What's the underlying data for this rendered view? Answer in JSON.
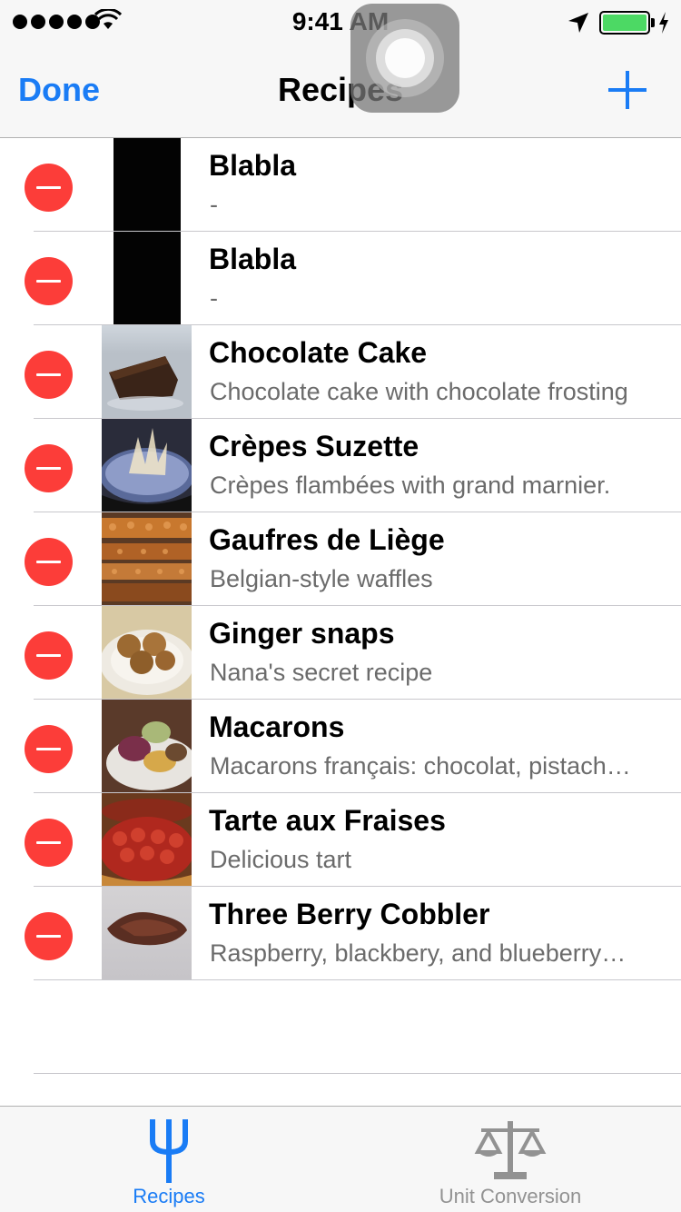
{
  "status_bar": {
    "time": "9:41 AM",
    "signal_bars": 5,
    "battery_level": 1.0,
    "icons": [
      "signal-dots-icon",
      "wifi-icon",
      "location-arrow-icon",
      "battery-icon",
      "charging-bolt-icon"
    ]
  },
  "navbar": {
    "left_button": "Done",
    "title": "Recipes",
    "right_icon": "plus-icon"
  },
  "colors": {
    "tint": "#1a7cf5",
    "delete": "#fc3d39",
    "inactive_tab": "#929292",
    "subtitle": "#6b6b6b"
  },
  "recipes": [
    {
      "title": "Blabla",
      "subtitle": "-",
      "image": "dark-placeholder"
    },
    {
      "title": "Blabla",
      "subtitle": "-",
      "image": "dark-placeholder"
    },
    {
      "title": "Chocolate Cake",
      "subtitle": "Chocolate cake with chocolate frosting",
      "image": "chocolate-cake-photo"
    },
    {
      "title": "Crèpes Suzette",
      "subtitle": "Crèpes flambées with grand marnier.",
      "image": "crepes-suzette-photo"
    },
    {
      "title": "Gaufres de Liège",
      "subtitle": "Belgian-style waffles",
      "image": "waffles-photo"
    },
    {
      "title": "Ginger snaps",
      "subtitle": "Nana's secret recipe",
      "image": "ginger-snaps-photo"
    },
    {
      "title": "Macarons",
      "subtitle": "Macarons français: chocolat, pistach…",
      "image": "macarons-photo"
    },
    {
      "title": "Tarte aux Fraises",
      "subtitle": "Delicious tart",
      "image": "strawberry-tart-photo"
    },
    {
      "title": "Three Berry Cobbler",
      "subtitle": "Raspberry, blackbery, and blueberry…",
      "image": "berry-cobbler-photo"
    }
  ],
  "tabs": [
    {
      "label": "Recipes",
      "icon": "fork-icon",
      "selected": true
    },
    {
      "label": "Unit Conversion",
      "icon": "scale-icon",
      "selected": false
    }
  ]
}
